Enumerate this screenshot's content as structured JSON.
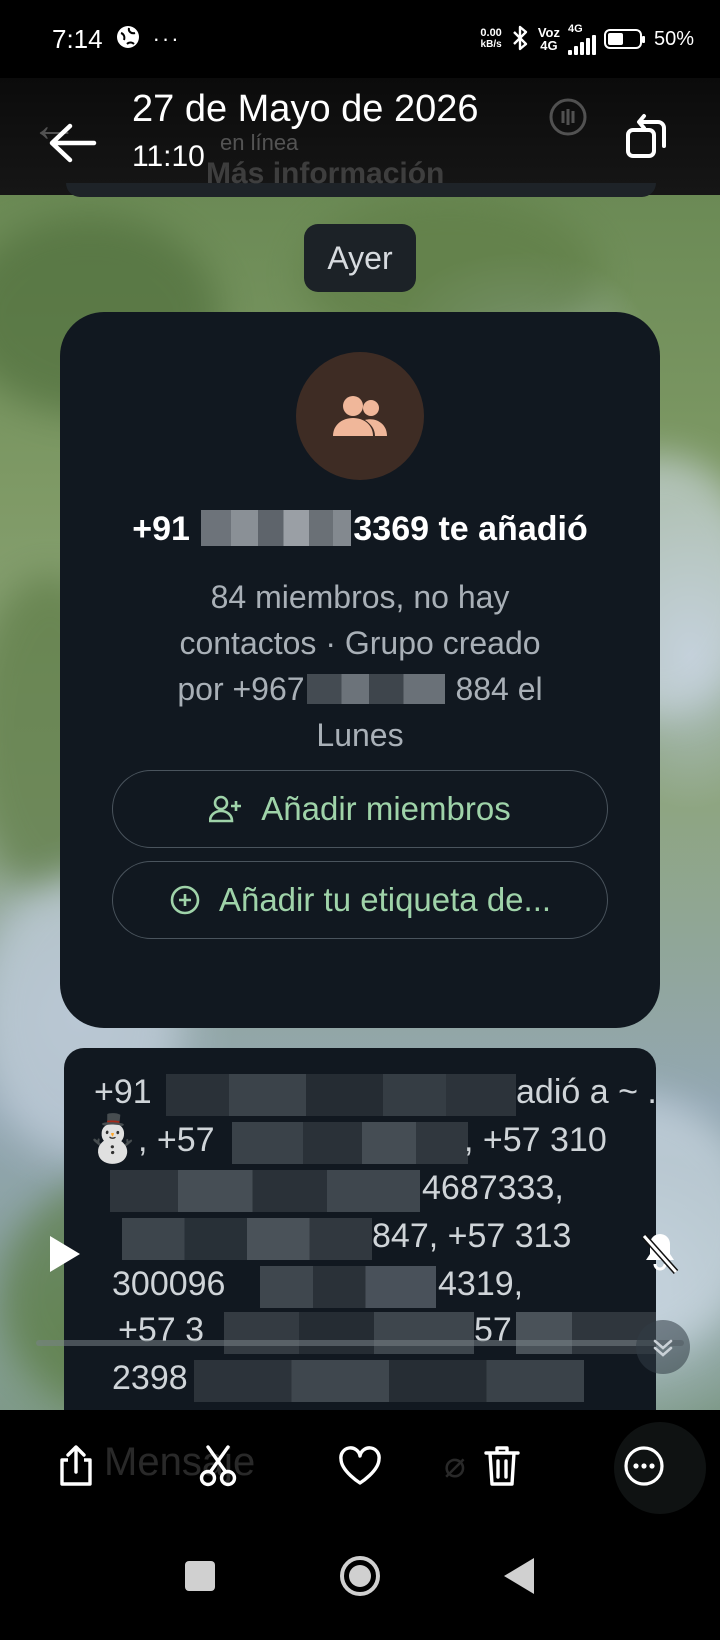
{
  "status_bar": {
    "time": "7:14",
    "more": "···",
    "net_speed_value": "0.00",
    "net_speed_unit": "kB/s",
    "volte_top": "Voz",
    "volte_bottom": "4G",
    "signal_label": "4G",
    "battery": "50%"
  },
  "header": {
    "ghost_subtitle": "en línea",
    "date": "27 de Mayo de 2026",
    "time": "11:10",
    "ghost_strip_text": "Más información"
  },
  "chat": {
    "date_chip": "Ayer",
    "group_card": {
      "added_prefix": "+91",
      "added_suffix": "3369 te añadió",
      "desc_line1": "84 miembros, no hay",
      "desc_line2": "contactos · Grupo creado",
      "desc_line3_prefix": "por +967",
      "desc_line3_suffix": "884 el",
      "desc_line4": "Lunes",
      "add_members": "Añadir miembros",
      "add_label": "Añadir tu etiqueta de..."
    },
    "system_message": {
      "l1_prefix": "+91",
      "l1_suffix": "adió a ~ .",
      "l2_prefix": ", +57",
      "l2_suffix": ", +57 310",
      "l3_suffix": "4687333,",
      "l4_suffix": "847, +57 313",
      "l5_prefix": "300096",
      "l5_suffix": "4319,",
      "l6_prefix": "+57 3",
      "l6_suffix": "57",
      "l7_prefix": "2398"
    }
  },
  "toolbar": {
    "ghost_input": "Mensaje",
    "icons": [
      "share-icon",
      "cut-icon",
      "heart-icon",
      "trash-icon",
      "more-icon"
    ]
  },
  "colors": {
    "card_bg": "#111820",
    "accent_green": "#9fd3a9",
    "avatar_bg": "#3e2c24",
    "avatar_fg": "#f0b79a"
  }
}
